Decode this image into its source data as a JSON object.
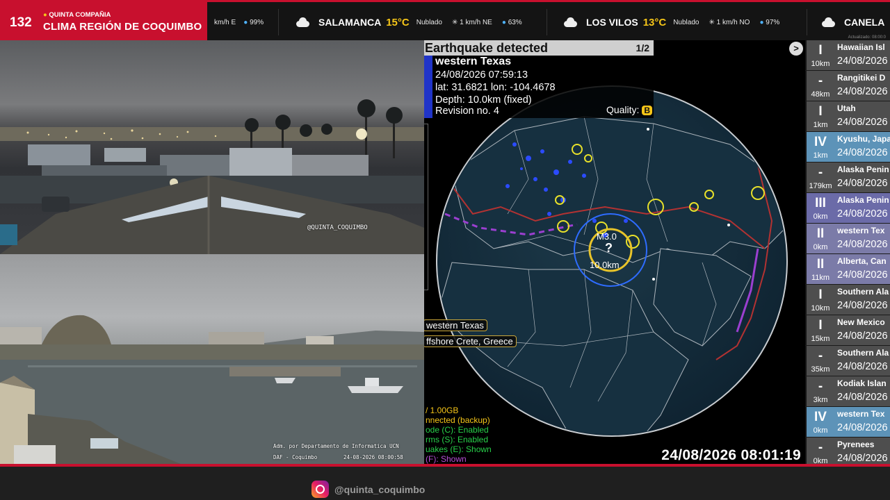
{
  "header": {
    "channel_number": "132",
    "brand_top": "QUINTA COMPAÑIA",
    "brand_title": "CLIMA REGIÓN DE COQUIMBO",
    "ticker_fragment": {
      "wind": "km/h E",
      "humidity": "99%"
    },
    "weather": [
      {
        "city": "SALAMANCA",
        "temp": "15°C",
        "condition": "Nublado",
        "wind": "1 km/h NE",
        "humidity": "63%",
        "icon": "cloud-icon"
      },
      {
        "city": "LOS VILOS",
        "temp": "13°C",
        "condition": "Nublado",
        "wind": "1 km/h NO",
        "humidity": "97%",
        "icon": "cloud-icon"
      },
      {
        "city": "CANELA",
        "icon": "cloud-icon"
      }
    ],
    "updated": "Actualizado: 08:00:0"
  },
  "cameras": {
    "cam1_watermark": "@QUINTA_COQUIMBO",
    "cam2_credit": "Adm. por Departamento de Informatica UCN",
    "cam2_location": "DAF - Coquimbo",
    "cam2_timestamp": "24-08-2026 08:00:58"
  },
  "quake": {
    "title": "Earthquake detected",
    "page": "1/2",
    "place": "western Texas",
    "datetime": "24/08/2026 07:59:13",
    "latlon": "lat: 31.6821 lon: -104.4678",
    "depth": "Depth: 10.0km (fixed)",
    "revision": "Revision no. 4",
    "quality_label": "Quality:",
    "quality_value": "B",
    "marker_mag": "M3.0",
    "marker_depth": "10.0km",
    "marker_unknown": "?",
    "tags": [
      "western Texas",
      "ffshore Crete, Greece"
    ],
    "status": [
      {
        "text": "/ 1.00GB",
        "color": "#f5c518"
      },
      {
        "text": "nnected (backup)",
        "color": "#f5c518"
      },
      {
        "text": "ode (C): Enabled",
        "color": "#28d24a"
      },
      {
        "text": "rms (S): Enabled",
        "color": "#28d24a"
      },
      {
        "text": "uakes (E): Shown",
        "color": "#28d24a"
      },
      {
        "text": "(F): Shown",
        "color": "#b84fd8"
      }
    ],
    "clock": "24/08/2026 08:01:19"
  },
  "quake_list": [
    {
      "intensity": "I",
      "depth": "10km",
      "place": "Hawaiian Isl",
      "date": "24/08/2026",
      "color": "#4e4e4e"
    },
    {
      "intensity": "-",
      "depth": "48km",
      "place": "Rangitikei D",
      "date": "24/08/2026",
      "color": "#4e4e4e"
    },
    {
      "intensity": "I",
      "depth": "1km",
      "place": "Utah",
      "date": "24/08/2026",
      "color": "#4e4e4e"
    },
    {
      "intensity": "IV",
      "depth": "1km",
      "place": "Kyushu, Japa",
      "date": "24/08/2026",
      "color": "#5d93b8"
    },
    {
      "intensity": "-",
      "depth": "179km",
      "place": "Alaska Penin",
      "date": "24/08/2026",
      "color": "#4e4e4e"
    },
    {
      "intensity": "III",
      "depth": "0km",
      "place": "Alaska Penin",
      "date": "24/08/2026",
      "color": "#6b6ba8"
    },
    {
      "intensity": "II",
      "depth": "0km",
      "place": "western Tex",
      "date": "24/08/2026",
      "color": "#7b7ba8"
    },
    {
      "intensity": "II",
      "depth": "11km",
      "place": "Alberta, Can",
      "date": "24/08/2026",
      "color": "#7b7ba8"
    },
    {
      "intensity": "I",
      "depth": "10km",
      "place": "Southern Ala",
      "date": "24/08/2026",
      "color": "#4e4e4e"
    },
    {
      "intensity": "I",
      "depth": "15km",
      "place": "New Mexico",
      "date": "24/08/2026",
      "color": "#4e4e4e"
    },
    {
      "intensity": "-",
      "depth": "35km",
      "place": "Southern Ala",
      "date": "24/08/2026",
      "color": "#4e4e4e"
    },
    {
      "intensity": "-",
      "depth": "3km",
      "place": "Kodiak Islan",
      "date": "24/08/2026",
      "color": "#4e4e4e"
    },
    {
      "intensity": "IV",
      "depth": "0km",
      "place": "western Tex",
      "date": "24/08/2026",
      "color": "#5d93b8"
    },
    {
      "intensity": "-",
      "depth": "0km",
      "place": "Pyrenees",
      "date": "24/08/2026",
      "color": "#4e4e4e"
    }
  ],
  "footer": {
    "instagram_handle": "@quinta_coquimbo",
    "icon": "instagram-icon"
  }
}
